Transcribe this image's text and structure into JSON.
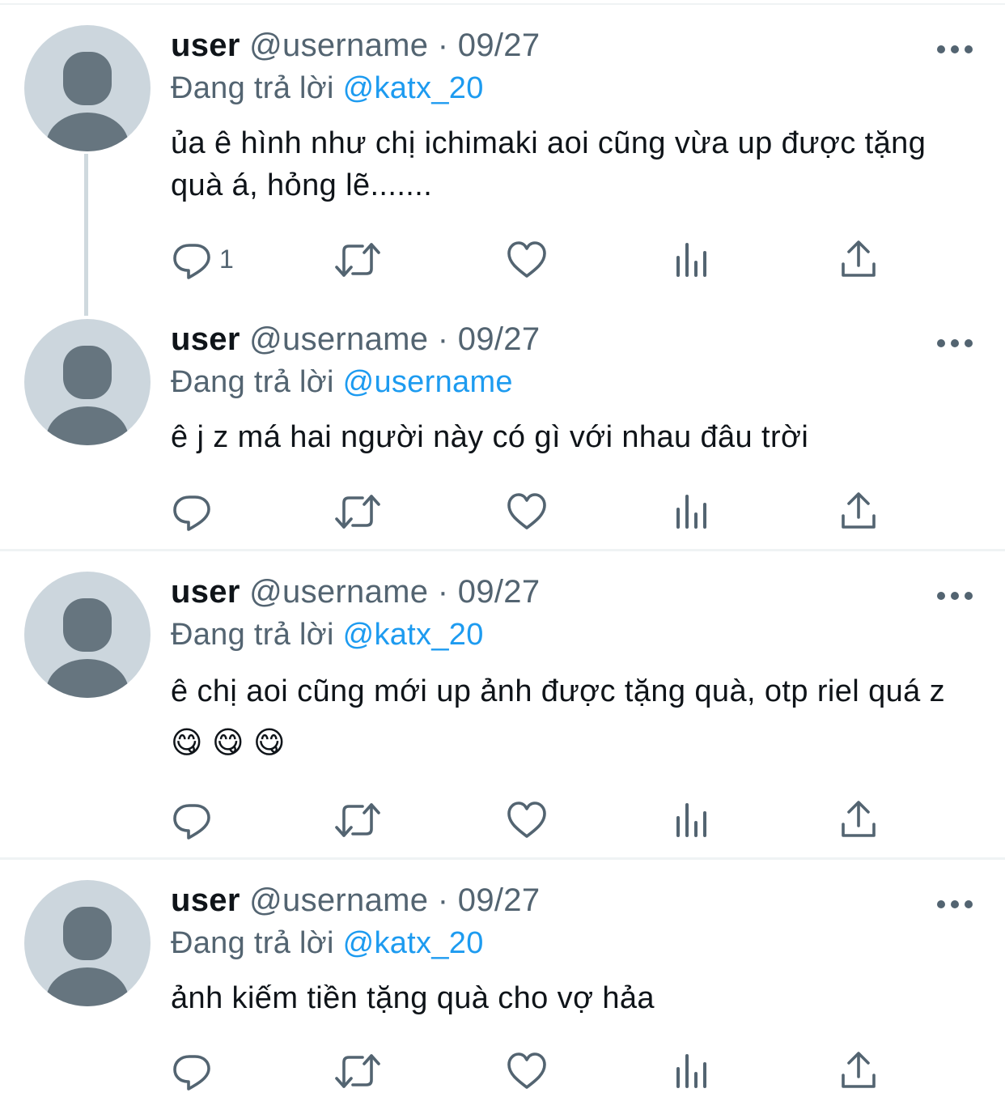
{
  "tweets": [
    {
      "name": "user",
      "handle": "@username",
      "separator": "·",
      "date": "09/27",
      "replying_prefix": "Đang trả lời",
      "replying_to": "@katx_20",
      "text": "ủa ê hình như chị ichimaki aoi cũng vừa up được tặng quà á, hỏng lẽ.......",
      "reply_count": "1"
    },
    {
      "name": "user",
      "handle": "@username",
      "separator": "·",
      "date": "09/27",
      "replying_prefix": "Đang trả lời",
      "replying_to": "@username",
      "text": "ê j z má hai người này có gì với nhau đâu trời",
      "reply_count": ""
    },
    {
      "name": "user",
      "handle": "@username",
      "separator": "·",
      "date": "09/27",
      "replying_prefix": "Đang trả lời",
      "replying_to": "@katx_20",
      "text": "ê chị aoi cũng mới up ảnh được tặng quà, otp riel quá z😋 😋 😋",
      "reply_count": ""
    },
    {
      "name": "user",
      "handle": "@username",
      "separator": "·",
      "date": "09/27",
      "replying_prefix": "Đang trả lời",
      "replying_to": "@katx_20",
      "text": "ảnh kiếm tiền tặng quà cho vợ hảa",
      "reply_count": ""
    }
  ],
  "icons": {
    "reply": "reply-icon",
    "retweet": "retweet-icon",
    "like": "like-icon",
    "views": "views-icon",
    "share": "share-icon",
    "more": "more-icon"
  },
  "colors": {
    "text": "#0f1419",
    "secondary": "#536471",
    "link": "#1d9bf0",
    "avatar_bg": "#ccd6dd",
    "avatar_fg": "#66757f",
    "divider": "#eff3f4"
  }
}
